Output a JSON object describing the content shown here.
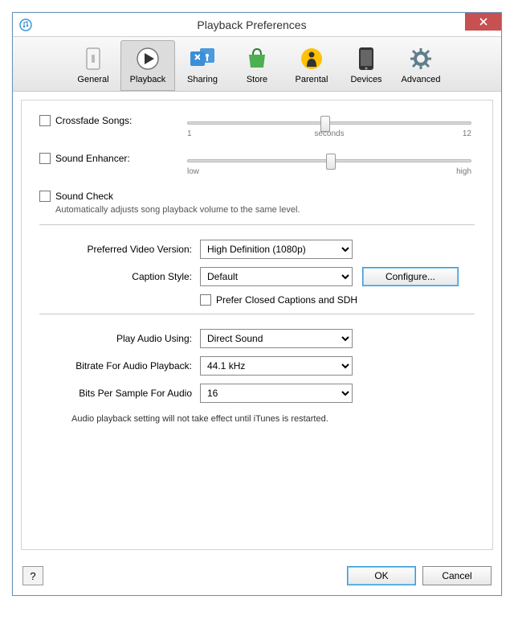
{
  "window": {
    "title": "Playback Preferences"
  },
  "tabs": [
    {
      "label": "General"
    },
    {
      "label": "Playback"
    },
    {
      "label": "Sharing"
    },
    {
      "label": "Store"
    },
    {
      "label": "Parental"
    },
    {
      "label": "Devices"
    },
    {
      "label": "Advanced"
    }
  ],
  "crossfade": {
    "label": "Crossfade Songs:",
    "min": "1",
    "mid": "seconds",
    "max": "12"
  },
  "enhancer": {
    "label": "Sound Enhancer:",
    "min": "low",
    "max": "high"
  },
  "soundcheck": {
    "label": "Sound Check",
    "desc": "Automatically adjusts song playback volume to the same level."
  },
  "video": {
    "preferred_label": "Preferred Video Version:",
    "preferred_value": "High Definition (1080p)",
    "caption_label": "Caption Style:",
    "caption_value": "Default",
    "configure": "Configure...",
    "prefer_cc": "Prefer Closed Captions and SDH"
  },
  "audio": {
    "play_using_label": "Play Audio Using:",
    "play_using_value": "Direct Sound",
    "bitrate_label": "Bitrate For Audio Playback:",
    "bitrate_value": "44.1 kHz",
    "bits_label": "Bits Per Sample For Audio",
    "bits_value": "16",
    "note": "Audio playback setting will not take effect until iTunes is restarted."
  },
  "buttons": {
    "help": "?",
    "ok": "OK",
    "cancel": "Cancel"
  }
}
